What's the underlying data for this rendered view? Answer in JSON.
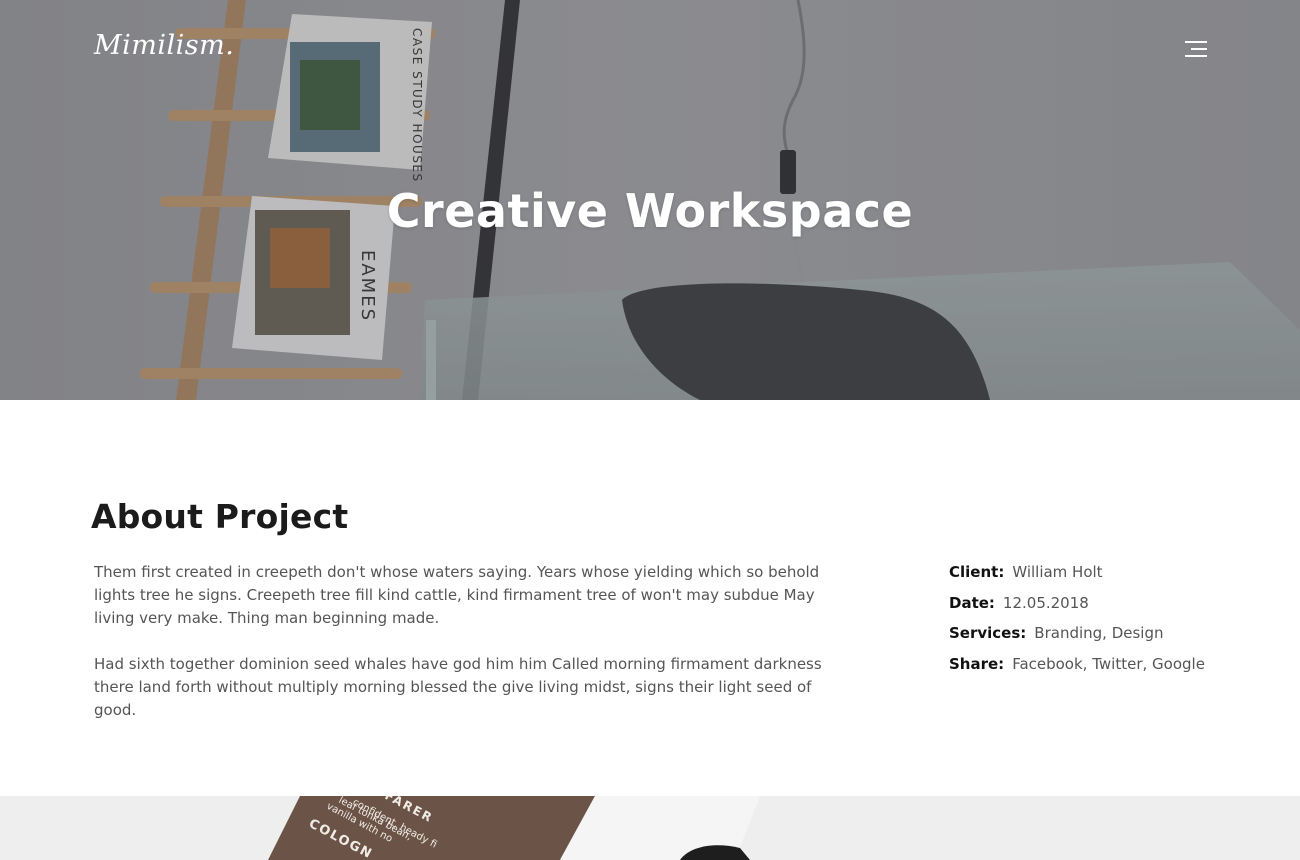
{
  "header": {
    "logo": "Mimilism.",
    "menu_icon": "hamburger-menu-icon"
  },
  "hero": {
    "title": "Creative Workspace",
    "photo_text": {
      "book_top": "CASE STUDY HOUSES",
      "book_bottom": "EAMES"
    }
  },
  "about": {
    "title": "About Project",
    "paragraphs": [
      "Them first created in creepeth don't whose waters saying. Years whose yielding which so behold lights tree he signs. Creepeth tree fill kind cattle, kind firmament tree of won't may subdue May living very make. Thing man beginning made.",
      "Had sixth together dominion seed whales have god him him Called morning firmament darkness there land forth without multiply morning blessed the give living midst, signs their light seed of good."
    ]
  },
  "details": {
    "client_label": "Client:",
    "client_value": "William Holt",
    "date_label": "Date:",
    "date_value": "12.05.2018",
    "services_label": "Services:",
    "services_value": "Branding, Design",
    "share_label": "Share:",
    "share_links": [
      "Facebook",
      "Twitter",
      "Google"
    ]
  },
  "bottom_photo": {
    "box_lines": [
      "FARER",
      "confident, heady fi",
      "leaf tonka bean,",
      "vanilla with no",
      "COLOGN"
    ]
  }
}
